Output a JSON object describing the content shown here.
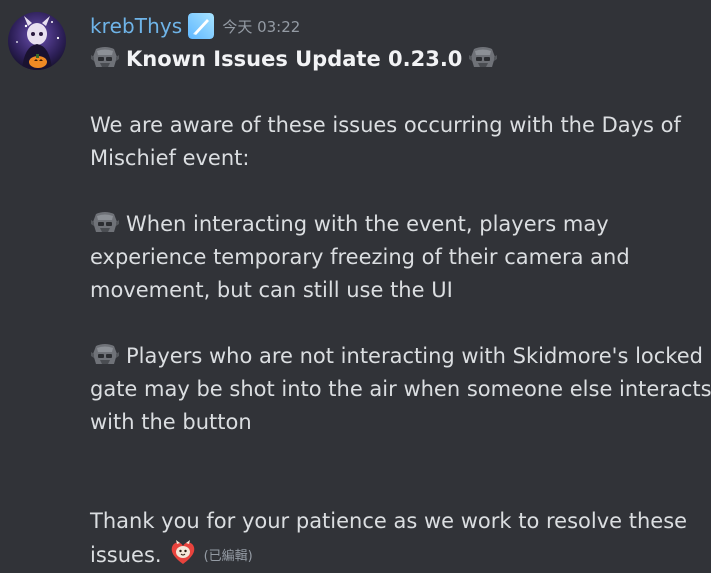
{
  "author": {
    "username": "krebThys",
    "timestamp": "今天 03:22",
    "avatar_icon": "avatar-image",
    "badge_icon": "role-badge-icon"
  },
  "message": {
    "title": "Known Issues Update 0.23.0",
    "title_emoji": "robot-head-emoji",
    "intro_line1": "We are aware of these issues occurring with the Days of",
    "intro_line2": "Mischief event:",
    "issue1_line1": "When interacting with the event, players may",
    "issue1_line2": "experience temporary freezing of their camera and",
    "issue1_line3": "movement, but can still use the UI",
    "issue2_line1": "Players who are not interacting with Skidmore's locked",
    "issue2_line2": "gate may be shot into the air when someone else interacts",
    "issue2_line3": "with the button",
    "outro_line1": "Thank you for your patience as we work to resolve these",
    "outro_line2": "issues.",
    "outro_emoji": "heart-character-emoji",
    "edited_label": "(已編輯)"
  },
  "colors": {
    "background": "#313338",
    "text": "#dbdee1",
    "username": "#6fb4e8",
    "muted": "#949ba4"
  }
}
